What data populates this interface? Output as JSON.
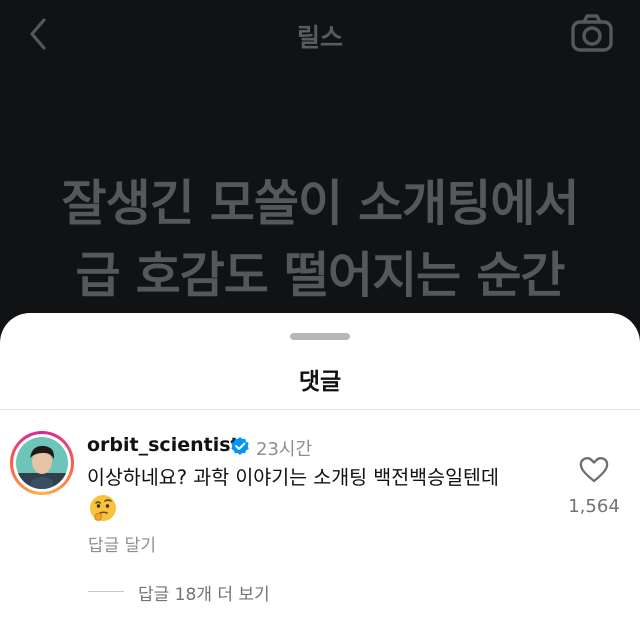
{
  "header": {
    "title": "릴스",
    "back_icon": "chevron-left-icon",
    "camera_icon": "camera-icon"
  },
  "video": {
    "caption_line1": "잘생긴 모쏠이 소개팅에서",
    "caption_line2": "급 호감도 떨어지는 순간"
  },
  "comments_sheet": {
    "title": "댓글",
    "comment": {
      "username": "orbit_scientist",
      "verified": true,
      "time": "23시간",
      "text": "이상하네요? 과학 이야기는 소개팅 백전백승일텐데",
      "emoji": "🤔",
      "reply_label": "답글 달기",
      "like_count": "1,564",
      "more_replies_label": "답글 18개 더 보기"
    }
  },
  "colors": {
    "background_dark": "#101214",
    "sheet_background": "#ffffff",
    "verified_blue": "#0095f6",
    "muted_text": "#8e8e8e"
  }
}
